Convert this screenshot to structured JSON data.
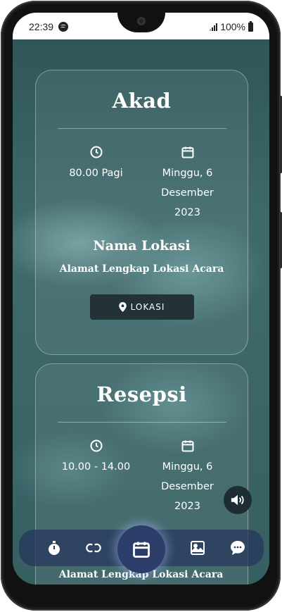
{
  "status_bar": {
    "time": "22:39",
    "battery": "100%",
    "icons": [
      "spotify-icon",
      "signal-icon",
      "battery-icon"
    ]
  },
  "akad": {
    "title": "Akad",
    "time": "80.00 Pagi",
    "date": "Minggu, 6 Desember 2023",
    "location_name": "Nama Lokasi",
    "address": "Alamat Lengkap Lokasi Acara",
    "button_label": "LOKASI"
  },
  "resepsi": {
    "title": "Resepsi",
    "time": "10.00 - 14.00",
    "date": "Minggu, 6 Desember 2023",
    "address": "Alamat Lengkap Lokasi Acara"
  },
  "nav": {
    "items": [
      "stopwatch-icon",
      "couple-icon",
      "calendar-icon",
      "gallery-icon",
      "chat-icon"
    ],
    "active": "calendar-icon"
  },
  "colors": {
    "background": "#3c6668",
    "button": "#223236",
    "nav": "#26345c",
    "nav_active": "#2b3d68"
  }
}
